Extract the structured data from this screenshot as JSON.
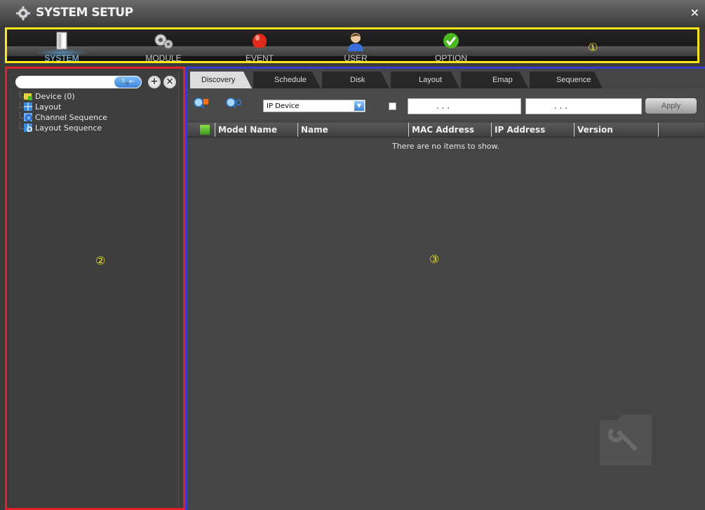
{
  "window": {
    "title": "SYSTEM SETUP",
    "close_symbol": "×"
  },
  "nav": {
    "items": [
      {
        "label": "SYSTEM",
        "icon": "system-icon",
        "active": true
      },
      {
        "label": "MODULE",
        "icon": "module-gears-icon",
        "active": false
      },
      {
        "label": "EVENT",
        "icon": "event-siren-icon",
        "active": false
      },
      {
        "label": "USER",
        "icon": "user-icon",
        "active": false
      },
      {
        "label": "OPTION",
        "icon": "option-check-icon",
        "active": false
      }
    ],
    "marker": "①"
  },
  "left": {
    "search": {
      "value": "",
      "placeholder": ""
    },
    "tree": [
      {
        "label": "Device (0)",
        "icon": "device-folder-icon"
      },
      {
        "label": "Layout",
        "icon": "layout-grid-icon"
      },
      {
        "label": "Channel Sequence",
        "icon": "channel-sequence-icon"
      },
      {
        "label": "Layout Sequence",
        "icon": "layout-sequence-icon"
      }
    ],
    "marker": "②"
  },
  "right": {
    "tabs": [
      "Discovery",
      "Schedule",
      "Disk",
      "Layout",
      "Emap",
      "Sequence"
    ],
    "active_tab": "Discovery",
    "device_type": "IP Device",
    "ip_start": ". . .",
    "ip_end": ". . .",
    "apply_label": "Apply",
    "columns": [
      "Model Name",
      "Name",
      "MAC Address",
      "IP Address",
      "Version"
    ],
    "empty_message": "There are no items to show.",
    "marker": "③"
  },
  "colors": {
    "highlight_yellow": "#ffe81a",
    "highlight_red": "#e0202a",
    "highlight_blue": "#3a3acc",
    "active_nav": "#8fd6ff"
  }
}
